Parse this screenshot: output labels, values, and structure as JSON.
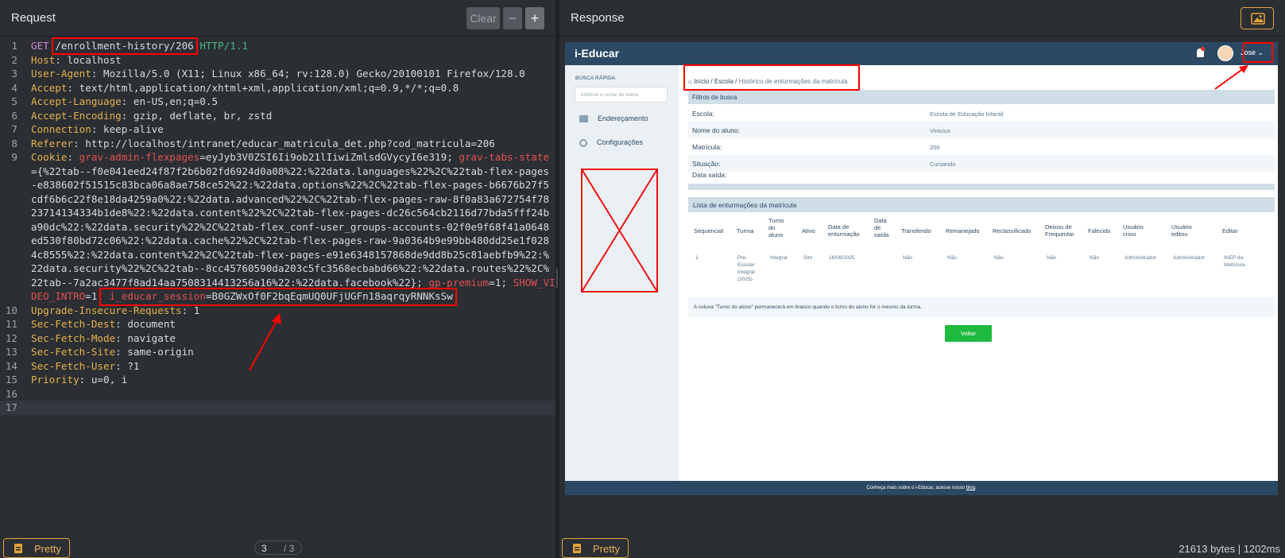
{
  "request": {
    "title": "Request",
    "buttons": {
      "clear": "Clear",
      "minus": "−",
      "plus": "+"
    },
    "lines": [
      {
        "n": "1"
      },
      {
        "n": "2"
      },
      {
        "n": "3"
      },
      {
        "n": "4"
      },
      {
        "n": "5"
      },
      {
        "n": "6"
      },
      {
        "n": "7"
      },
      {
        "n": "8"
      },
      {
        "n": "9"
      },
      {
        "n": "10"
      },
      {
        "n": "11"
      },
      {
        "n": "12"
      },
      {
        "n": "13"
      },
      {
        "n": "14"
      },
      {
        "n": "15"
      },
      {
        "n": "16"
      },
      {
        "n": "17"
      }
    ],
    "method": "GET",
    "path": "/enrollment-history/206",
    "version": "HTTP/1.1",
    "headers": {
      "host_k": "Host",
      "host_v": "localhost",
      "ua_k": "User-Agent",
      "ua_v": "Mozilla/5.0 (X11; Linux x86_64; rv:128.0) Gecko/20100101 Firefox/128.0",
      "accept_k": "Accept",
      "accept_v": "text/html,application/xhtml+xml,application/xml;q=0.9,*/*;q=0.8",
      "lang_k": "Accept-Language",
      "lang_v": "en-US,en;q=0.5",
      "enc_k": "Accept-Encoding",
      "enc_v": "gzip, deflate, br, zstd",
      "conn_k": "Connection",
      "conn_v": "keep-alive",
      "ref_k": "Referer",
      "ref_v": "http://localhost/intranet/educar_matricula_det.php?cod_matricula=206",
      "cookie_k": "Cookie",
      "c1_k": "grav-admin-flexpages",
      "c1_v": "eyJyb3V0ZSI6Ii9ob21lIiwiZmlsdGVycyI6e319",
      "c2_k": "grav-tabs-state",
      "c2_l1": "={%22tab--f0e041eed24f87f2b6b02fd6924d0a08%22:%22data.languages%22%2C%22tab-flex-pages",
      "c2_l2": "-e838602f51515c83bca06a8ae758ce52%22:%22data.options%22%2C%22tab-flex-pages-b6676b27f5",
      "c2_l3": "cdf6b6c22f8e18da4259a0%22:%22data.advanced%22%2C%22tab-flex-pages-raw-8f0a83a672754f78",
      "c2_l4": "23714134334b1de8%22:%22data.content%22%2C%22tab-flex-pages-dc26c564cb2116d77bda5fff24b",
      "c2_l5": "a90dc%22:%22data.security%22%2C%22tab-flex_conf-user_groups-accounts-02f0e9f68f41a0648",
      "c2_l6": "ed530f80bd72c06%22:%22data.cache%22%2C%22tab-flex-pages-raw-9a0364b9e99bb480dd25e1f028",
      "c2_l7": "4c8555%22:%22data.content%22%2C%22tab-flex-pages-e91e6348157868de9dd8b25c81aebfb9%22:%",
      "c2_l8": "22data.security%22%2C%22tab--8cc45760590da203c5fc3568ecbabd66%22:%22data.routes%22%2C%",
      "c2_l9": "22tab--7a2ac3477f8ad14aa7508314413256a16%22:%22data.facebook%22}",
      "c3_k": "gp-premium",
      "c3_v": "1",
      "c4_k1": "SHOW_VI",
      "c4_k2": "DEO_INTRO",
      "c4_v": "1",
      "c5_k": "i_educar_session",
      "c5_v": "B0GZWxOf0F2bqEqmUQ0UFjUGFn18aqrqyRNNKsSw",
      "uir_k": "Upgrade-Insecure-Requests",
      "uir_v": "1",
      "sfd_k": "Sec-Fetch-Dest",
      "sfd_v": "document",
      "sfm_k": "Sec-Fetch-Mode",
      "sfm_v": "navigate",
      "sfs_k": "Sec-Fetch-Site",
      "sfs_v": "same-origin",
      "sfu_k": "Sec-Fetch-User",
      "sfu_v": "?1",
      "pri_k": "Priority",
      "pri_v": "u=0, i"
    },
    "pretty": "Pretty",
    "pager": {
      "current": "3",
      "total": "/ 3"
    }
  },
  "response": {
    "title": "Response",
    "pretty": "Pretty",
    "status": "21613 bytes  |  1202ms",
    "app": {
      "brand": "i-Educar",
      "user": "Jose",
      "sidebar": {
        "title": "BUSCA RÁPIDA",
        "search_placeholder": "Informe o nome do menu",
        "items": [
          "Endereçamento",
          "Configurações"
        ]
      },
      "breadcrumb": {
        "home": "Início",
        "school": "Escola",
        "current": "Histórico de enturmações da matrícula"
      },
      "filters_title": "Filtros de busca",
      "filters": [
        {
          "label": "Escola:",
          "value": "Escola de Educação Infantil"
        },
        {
          "label": "Nome do aluno:",
          "value": "Vinicius"
        },
        {
          "label": "Matrícula:",
          "value": "206"
        },
        {
          "label": "Situação:",
          "value": "Cursando"
        },
        {
          "label": "Data saída:",
          "value": ""
        }
      ],
      "list_title": "Lista de enturmações da matrícula",
      "columns": [
        "Sequencial",
        "Turma",
        "Turno do aluno",
        "Ativo",
        "Data de enturmação",
        "Data de saída",
        "Transferido",
        "Remanejado",
        "Reclassificado",
        "Deixou de Frequentar",
        "Falecido",
        "Usuário criou",
        "Usuário editou",
        "Editar"
      ],
      "row": [
        "1",
        "Pré-Escolar Integral (2025)",
        "Integral",
        "Sim",
        "16/08/2025",
        "",
        "Não",
        "Não",
        "Não",
        "Não",
        "Não",
        "Administrador",
        "Administrador",
        "INEP da Matrícula"
      ],
      "note": "A coluna \"Turno do aluno\" permanecerá em branco quando o turno do aluno for o mesmo da turma.",
      "back_button": "Voltar",
      "footer_text": "Conheça mais sobre o i-Educar, acesse nosso",
      "footer_link": "blog"
    }
  },
  "colors": {
    "accent": "#e3a23b",
    "highlight": "#ff0000",
    "brand": "#2c4964",
    "voltar": "#1dba3f"
  }
}
